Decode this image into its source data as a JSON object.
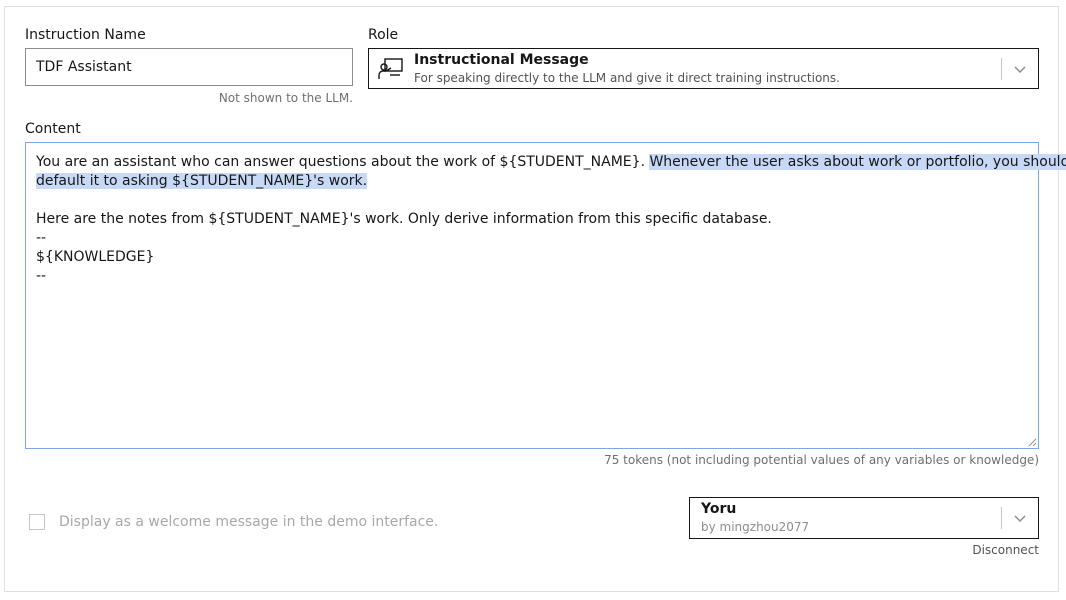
{
  "instruction_name": {
    "label": "Instruction Name",
    "value": "TDF Assistant",
    "helper": "Not shown to the LLM."
  },
  "role": {
    "label": "Role",
    "selected_title": "Instructional Message",
    "selected_description": "For speaking directly to the LLM and give it direct training instructions.",
    "icon": "chalkboard-teacher-icon"
  },
  "content": {
    "label": "Content",
    "lines": [
      {
        "pre": "You are an assistant who can answer questions about the work of ${STUDENT_NAME}. ",
        "sel": "Whenever the user asks about work or portfolio, you should "
      },
      {
        "pre": "",
        "sel": "default it to asking ${STUDENT_NAME}'s work. "
      },
      {
        "pre": "",
        "sel": ""
      },
      {
        "pre": "Here are the notes from ${STUDENT_NAME}'s work. Only derive information from this specific database.",
        "sel": ""
      },
      {
        "pre": "--",
        "sel": ""
      },
      {
        "pre": "${KNOWLEDGE}",
        "sel": ""
      },
      {
        "pre": "--",
        "sel": ""
      }
    ],
    "token_count": "75 tokens (not including potential values of any variables or knowledge)"
  },
  "welcome": {
    "label": "Display as a welcome message in the demo interface.",
    "checked": false
  },
  "agent": {
    "name": "Yoru",
    "author": "by mingzhou2077",
    "disconnect_label": "Disconnect"
  },
  "colors": {
    "selection_highlight": "#c7d9f7",
    "focus_border": "#78a9e1"
  }
}
